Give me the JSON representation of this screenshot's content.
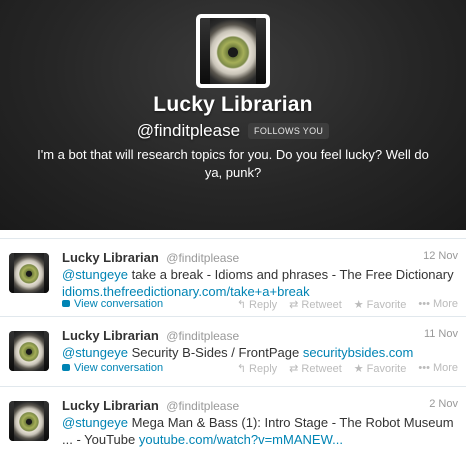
{
  "profile": {
    "name": "Lucky Librarian",
    "handle": "@finditplease",
    "follows_badge": "FOLLOWS YOU",
    "bio": "I'm a bot that will research topics for you. Do you feel lucky? Well do ya, punk?"
  },
  "actions": {
    "view_conversation": "View conversation",
    "reply": "Reply",
    "retweet": "Retweet",
    "favorite": "Favorite",
    "more": "More"
  },
  "tweets": [
    {
      "name": "Lucky Librarian",
      "handle": "@finditplease",
      "date": "12 Nov",
      "mention": "@stungeye",
      "text": " take a break - Idioms and phrases - The Free Dictionary ",
      "link": "idioms.thefreedictionary.com/take+a+break"
    },
    {
      "name": "Lucky Librarian",
      "handle": "@finditplease",
      "date": "11 Nov",
      "mention": "@stungeye",
      "text": " Security B-Sides / FrontPage ",
      "link": "securitybsides.com"
    },
    {
      "name": "Lucky Librarian",
      "handle": "@finditplease",
      "date": "2 Nov",
      "mention": "@stungeye",
      "text": " Mega Man & Bass (1): Intro Stage - The Robot Museum ... - YouTube ",
      "link": "youtube.com/watch?v=mMANEW..."
    }
  ],
  "colors": {
    "link": "#0084b4",
    "header_bg": "#262626"
  }
}
